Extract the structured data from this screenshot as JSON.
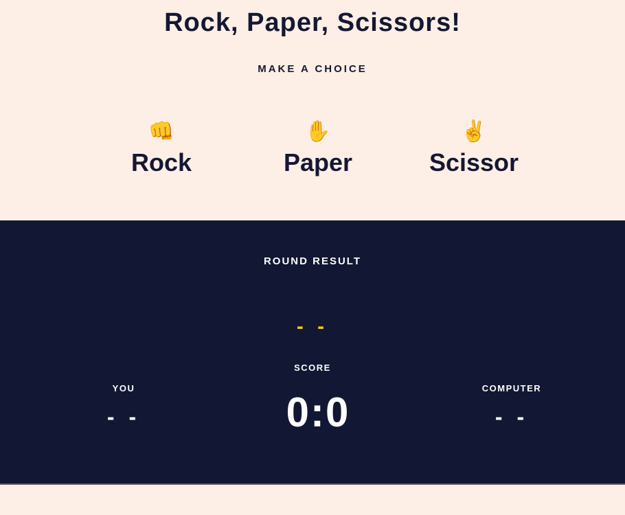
{
  "header": {
    "title": "Rock, Paper, Scissors!",
    "subtitle": "MAKE A CHOICE"
  },
  "choices": [
    {
      "label": "Rock",
      "emoji": "👊",
      "icon": "fist-icon"
    },
    {
      "label": "Paper",
      "emoji": "✋",
      "icon": "raised-hand-icon"
    },
    {
      "label": "Scissor",
      "emoji": "✌️",
      "icon": "victory-hand-icon"
    }
  ],
  "result": {
    "label": "ROUND RESULT",
    "value": "- -"
  },
  "score": {
    "label": "SCORE",
    "value": "0:0"
  },
  "player": {
    "label": "YOU",
    "value": "- -"
  },
  "computer": {
    "label": "COMPUTER",
    "value": "- -"
  },
  "colors": {
    "background": "#fdefe5",
    "panel": "#121733",
    "accent": "#f5c518",
    "text_dark": "#151833",
    "text_light": "#ffffff"
  }
}
